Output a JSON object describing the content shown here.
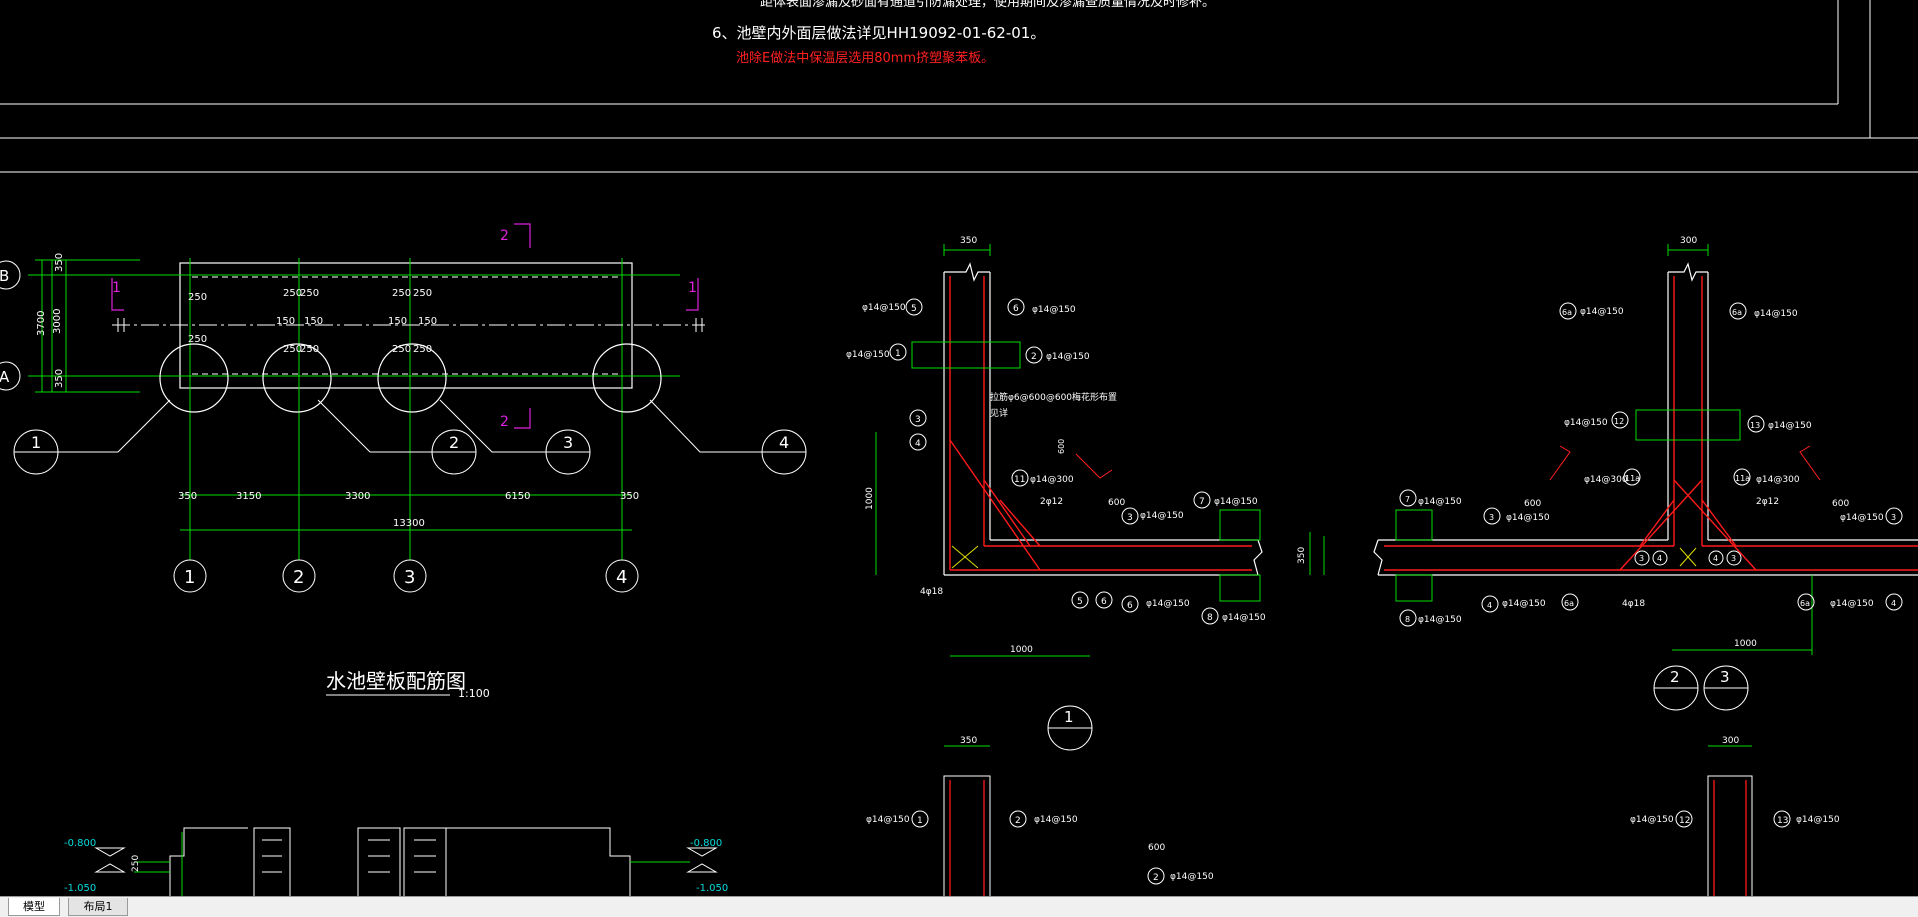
{
  "notes": {
    "top_partial": "距体表面渗漏及砂面有通道引防漏处理，使用期间及渗漏查质量情况及时修补。",
    "line6": "6、池壁内外面层做法详见HH19092-01-62-01。",
    "red_note": "池除E做法中保温层选用80mm挤塑聚苯板。"
  },
  "plan": {
    "axis_rows": [
      "B",
      "A"
    ],
    "axis_cols": [
      "1",
      "2",
      "3",
      "4"
    ],
    "section_mark_2": "2",
    "section_mark_1": "1",
    "dim_3700": "3700",
    "dim_3000": "3000",
    "dim_350": "350",
    "dim_250": "250",
    "dim_150": "150",
    "spans": [
      "350",
      "3150",
      "3300",
      "6150",
      "350"
    ],
    "total": "13300",
    "callouts": [
      "1",
      "2",
      "3",
      "4"
    ],
    "title": "水池壁板配筋图",
    "scale": "1:100"
  },
  "detail1": {
    "wall_thk": "350",
    "bar_a": "φ14@150",
    "bar_b": "φ14@150",
    "bar_c": "φ14@150",
    "bar_d": "φ14@150",
    "bar_300": "φ14@300",
    "bar_2d12": "2φ12",
    "bar_4d18": "4φ18",
    "note_hook": "拉筋φ6@600@600梅花形布置",
    "note_hook2": "见详",
    "dim_600": "600",
    "dim_1000": "1000",
    "dim_1000b": "1000",
    "dim_350b": "350",
    "marks": [
      "5",
      "6",
      "1",
      "2",
      "3",
      "4",
      "11",
      "3",
      "7",
      "5",
      "6",
      "6",
      "8"
    ],
    "callout": "1"
  },
  "detail23": {
    "wall_thk": "300",
    "bar": "φ14@150",
    "bar_300": "φ14@300",
    "bar_2d12": "2φ12",
    "bar_4d18": "4φ18",
    "dim_600": "600",
    "dim_1000": "1000",
    "marks": [
      "6a",
      "6a",
      "12",
      "13",
      "11a",
      "11a",
      "7",
      "3",
      "8",
      "4",
      "6a",
      "6a",
      "4",
      "3",
      "4",
      "3"
    ],
    "callout_left": "2",
    "callout_right": "3"
  },
  "bottom": {
    "elev1": "-0.800",
    "elev2": "-1.050",
    "elev3": "-0.800",
    "elev4": "-1.050",
    "dim_250": "250",
    "dim_350": "350",
    "dim_300": "300",
    "dim_600": "600",
    "bar": "φ14@150"
  },
  "tabs": {
    "model": "模型",
    "layout1": "布局1"
  }
}
